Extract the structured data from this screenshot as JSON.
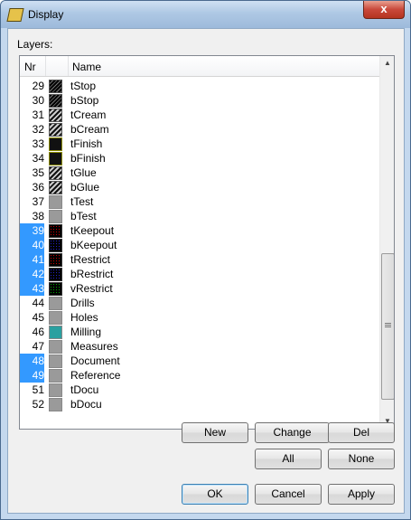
{
  "window": {
    "title": "Display",
    "close_label": "x"
  },
  "layers_label": "Layers:",
  "columns": {
    "nr": "Nr",
    "name": "Name"
  },
  "rows": [
    {
      "nr": "29",
      "name": "tStop",
      "selected": false,
      "pattern": "hatch",
      "color": "#000000"
    },
    {
      "nr": "30",
      "name": "bStop",
      "selected": false,
      "pattern": "hatch",
      "color": "#000000"
    },
    {
      "nr": "31",
      "name": "tCream",
      "selected": false,
      "pattern": "hatch-light",
      "color": "#555555"
    },
    {
      "nr": "32",
      "name": "bCream",
      "selected": false,
      "pattern": "hatch-light",
      "color": "#555555"
    },
    {
      "nr": "33",
      "name": "tFinish",
      "selected": false,
      "pattern": "hatch-yellow",
      "color": "#8a8a00"
    },
    {
      "nr": "34",
      "name": "bFinish",
      "selected": false,
      "pattern": "hatch-yellow",
      "color": "#8a8a00"
    },
    {
      "nr": "35",
      "name": "tGlue",
      "selected": false,
      "pattern": "hatch-light",
      "color": "#555555"
    },
    {
      "nr": "36",
      "name": "bGlue",
      "selected": false,
      "pattern": "hatch-light",
      "color": "#555555"
    },
    {
      "nr": "37",
      "name": "tTest",
      "selected": false,
      "pattern": "solid",
      "color": "#9a9a9a"
    },
    {
      "nr": "38",
      "name": "bTest",
      "selected": false,
      "pattern": "solid",
      "color": "#9a9a9a"
    },
    {
      "nr": "39",
      "name": "tKeepout",
      "selected": true,
      "pattern": "dots-red",
      "color": "#cc0000"
    },
    {
      "nr": "40",
      "name": "bKeepout",
      "selected": true,
      "pattern": "dots-blue",
      "color": "#2222cc"
    },
    {
      "nr": "41",
      "name": "tRestrict",
      "selected": true,
      "pattern": "dots-red",
      "color": "#cc0000"
    },
    {
      "nr": "42",
      "name": "bRestrict",
      "selected": true,
      "pattern": "dots-blue",
      "color": "#2222cc"
    },
    {
      "nr": "43",
      "name": "vRestrict",
      "selected": true,
      "pattern": "dots-green",
      "color": "#00aa00"
    },
    {
      "nr": "44",
      "name": "Drills",
      "selected": false,
      "pattern": "solid",
      "color": "#9a9a9a"
    },
    {
      "nr": "45",
      "name": "Holes",
      "selected": false,
      "pattern": "solid",
      "color": "#9a9a9a"
    },
    {
      "nr": "46",
      "name": "Milling",
      "selected": false,
      "pattern": "solid",
      "color": "#2aa0a0"
    },
    {
      "nr": "47",
      "name": "Measures",
      "selected": false,
      "pattern": "solid",
      "color": "#9a9a9a"
    },
    {
      "nr": "48",
      "name": "Document",
      "selected": true,
      "pattern": "solid",
      "color": "#9a9a9a"
    },
    {
      "nr": "49",
      "name": "Reference",
      "selected": true,
      "pattern": "solid",
      "color": "#9a9a9a"
    },
    {
      "nr": "51",
      "name": "tDocu",
      "selected": false,
      "pattern": "solid",
      "color": "#9a9a9a"
    },
    {
      "nr": "52",
      "name": "bDocu",
      "selected": false,
      "pattern": "solid",
      "color": "#9a9a9a"
    }
  ],
  "buttons": {
    "new": "New",
    "change": "Change",
    "del": "Del",
    "all": "All",
    "none": "None",
    "ok": "OK",
    "cancel": "Cancel",
    "apply": "Apply"
  },
  "icons": {
    "title": "layers-icon",
    "scroll_up": "scroll-up-arrow-icon",
    "scroll_down": "scroll-down-arrow-icon"
  },
  "colors": {
    "selection": "#3399ff",
    "titlebar": "#aec8e4",
    "close": "#c9483a"
  }
}
